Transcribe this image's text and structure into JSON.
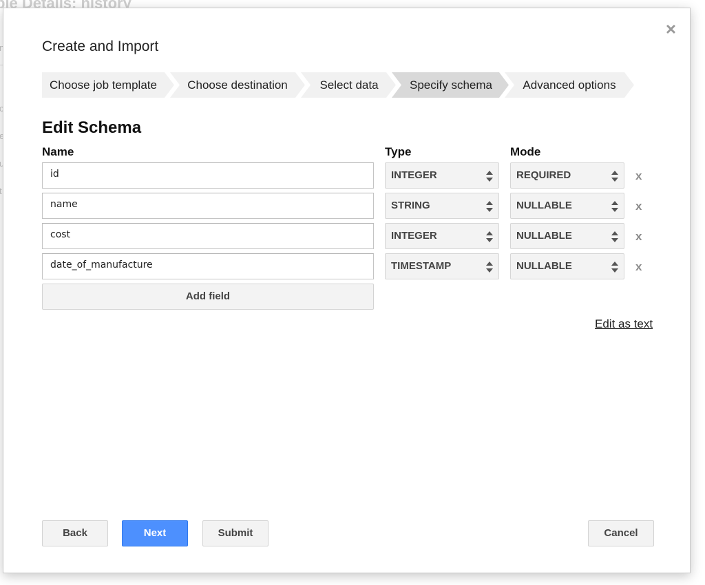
{
  "background": {
    "title": "ble Details: history",
    "letters": [
      "n",
      "c",
      "e",
      "u",
      "t"
    ]
  },
  "dialog": {
    "title": "Create and Import",
    "close_glyph": "×"
  },
  "steps": [
    {
      "label": "Choose job template",
      "active": false
    },
    {
      "label": "Choose destination",
      "active": false
    },
    {
      "label": "Select data",
      "active": false
    },
    {
      "label": "Specify schema",
      "active": true
    },
    {
      "label": "Advanced options",
      "active": false
    }
  ],
  "schema": {
    "title": "Edit Schema",
    "headers": {
      "name": "Name",
      "type": "Type",
      "mode": "Mode"
    },
    "fields": [
      {
        "name": "id",
        "type": "INTEGER",
        "mode": "REQUIRED"
      },
      {
        "name": "name",
        "type": "STRING",
        "mode": "NULLABLE"
      },
      {
        "name": "cost",
        "type": "INTEGER",
        "mode": "NULLABLE"
      },
      {
        "name": "date_of_manufacture",
        "type": "TIMESTAMP",
        "mode": "NULLABLE"
      }
    ],
    "remove_glyph": "x",
    "add_field_label": "Add field",
    "edit_as_text_label": "Edit as text"
  },
  "footer": {
    "back_label": "Back",
    "next_label": "Next",
    "submit_label": "Submit",
    "cancel_label": "Cancel"
  },
  "colors": {
    "primary": "#4d90fe",
    "step_bg": "#f1f1f1",
    "step_active_bg": "#d9d9d9"
  }
}
